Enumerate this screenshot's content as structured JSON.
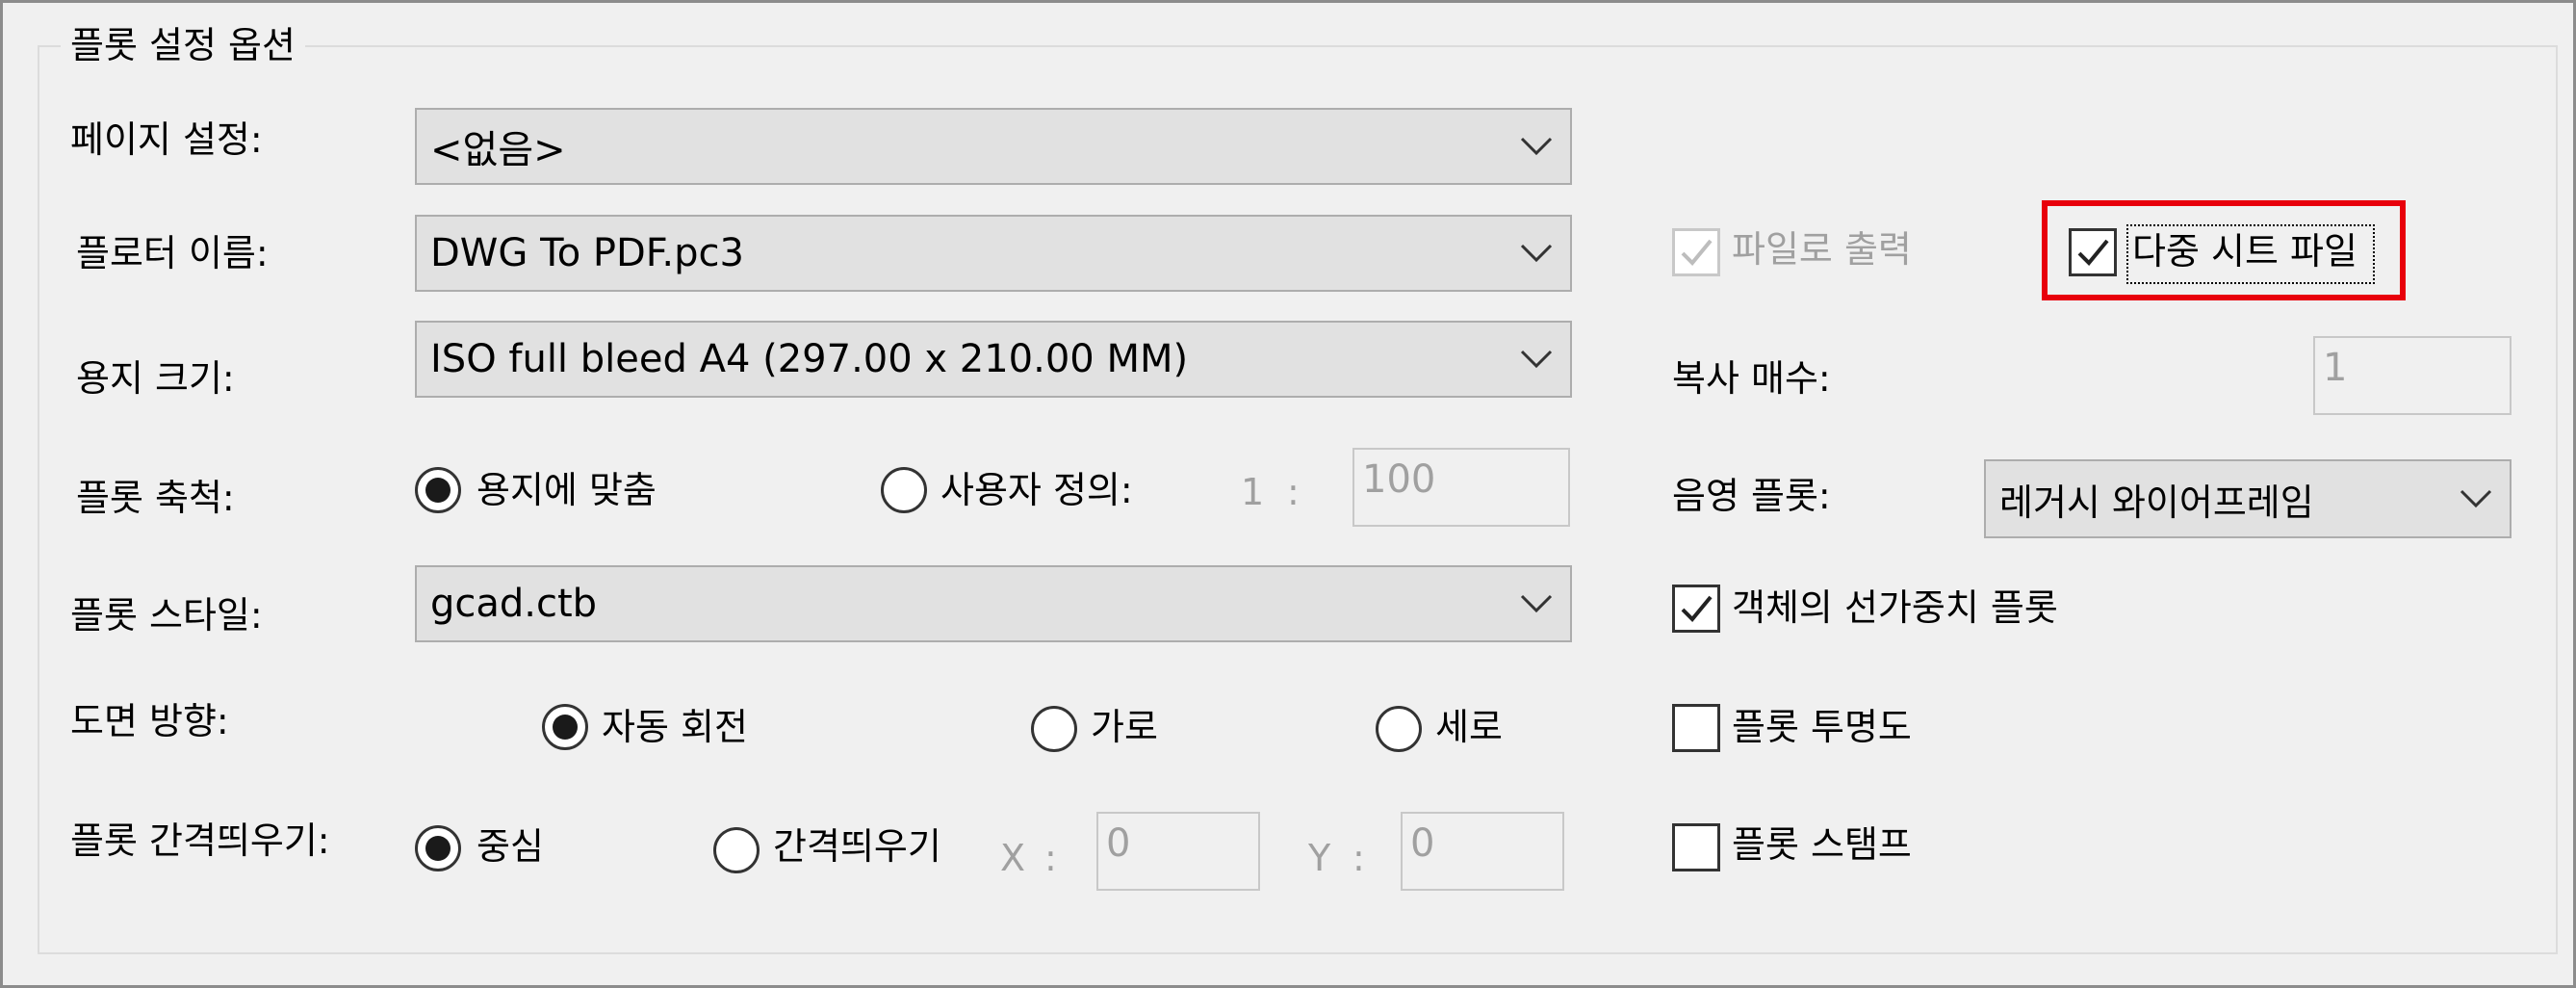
{
  "group_title": "플롯 설정 옵션",
  "page_setup": {
    "label": "페이지 설정:",
    "value": "<없음>"
  },
  "plotter_name": {
    "label": "플로터 이름:",
    "value": "DWG To PDF.pc3"
  },
  "paper_size": {
    "label": "용지 크기:",
    "value": "ISO full bleed A4 (297.00 x 210.00 MM)"
  },
  "plot_scale": {
    "label": "플롯 축척:",
    "fit_label": "용지에 맞춤",
    "fit_selected": true,
    "custom_label": "사용자 정의:",
    "ratio_left": "1",
    "ratio_sep": ":",
    "ratio_value": "100"
  },
  "plot_style": {
    "label": "플롯 스타일:",
    "value": "gcad.ctb"
  },
  "orientation": {
    "label": "도면 방향:",
    "options": [
      "자동 회전",
      "가로",
      "세로"
    ],
    "selected": "자동 회전"
  },
  "plot_offset": {
    "label": "플롯 간격띄우기:",
    "center_label": "중심",
    "offset_label": "간격띄우기",
    "center_selected": true,
    "x_label": "X",
    "y_label": "Y",
    "sep": ":",
    "x_value": "0",
    "y_value": "0"
  },
  "plot_to_file": {
    "label": "파일로 출력",
    "checked": true,
    "disabled": true
  },
  "multi_sheet": {
    "label": "다중 시트 파일",
    "checked": true,
    "highlighted": true,
    "highlight_color": "#e8000b"
  },
  "copies": {
    "label": "복사 매수:",
    "value": "1"
  },
  "shade_plot": {
    "label": "음영 플롯:",
    "value": "레거시 와이어프레임"
  },
  "lineweights": {
    "label": "객체의 선가중치 플롯",
    "checked": true
  },
  "transparency": {
    "label": "플롯 투명도",
    "checked": false
  },
  "stamp": {
    "label": "플롯 스탬프",
    "checked": false
  }
}
